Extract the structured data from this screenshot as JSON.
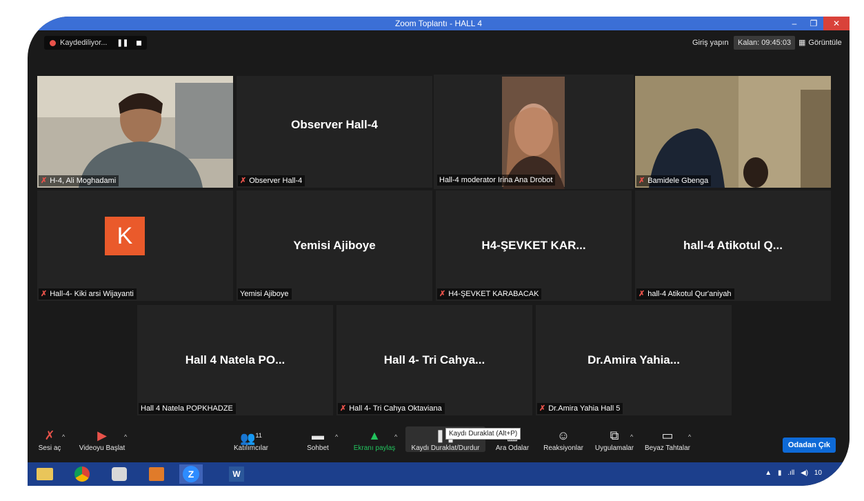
{
  "window": {
    "title": "Zoom Toplantı - HALL 4"
  },
  "recording": {
    "label": "Kaydediliyor...",
    "pause_glyph": "❚❚"
  },
  "topright": {
    "login": "Giriş yapın",
    "remaining": "Kalan: 09:45:03",
    "view": "Görüntüle"
  },
  "tiles": [
    {
      "big": "",
      "name": "H-4, Ali Moghadami",
      "muted": true
    },
    {
      "big": "Observer Hall-4",
      "name": "Observer Hall-4",
      "muted": true
    },
    {
      "big": "",
      "name": "Hall-4 moderator Irina Ana Drobot",
      "muted": false
    },
    {
      "big": "",
      "name": "Bamidele Gbenga",
      "muted": true
    },
    {
      "big": "K",
      "name": "Hall-4- Kiki arsi Wijayanti",
      "muted": true
    },
    {
      "big": "Yemisi Ajiboye",
      "name": "Yemisi Ajiboye",
      "muted": false
    },
    {
      "big": "H4-ŞEVKET  KAR...",
      "name": "H4-ŞEVKET KARABACAK",
      "muted": true
    },
    {
      "big": "hall-4  Atikotul Q...",
      "name": "hall-4 Atikotul Qur'aniyah",
      "muted": true
    },
    {
      "big": "Hall 4 Natela PO...",
      "name": "Hall 4 Natela POPKHADZE",
      "muted": false
    },
    {
      "big": "Hall 4- Tri Cahya...",
      "name": "Hall 4- Tri Cahya Oktaviana",
      "muted": true
    },
    {
      "big": "Dr.Amira  Yahia...",
      "name": "Dr.Amira Yahia Hall 5",
      "muted": true
    }
  ],
  "toolbar": {
    "audio": "Sesi aç",
    "video": "Videoyu Başlat",
    "participants": "Katılımcılar",
    "participants_count": "11",
    "chat": "Sohbet",
    "share": "Ekranı paylaş",
    "record": "Kaydı Duraklat/Durdur",
    "breakout": "Ara Odalar",
    "reactions": "Reaksiyonlar",
    "apps": "Uygulamalar",
    "whiteboard": "Beyaz Tahtalar",
    "leave": "Odadan Çık"
  },
  "tooltip": "Kaydı Duraklat (Alt+P)",
  "colors": {
    "titlebar": "#3b6fd6",
    "share_green": "#22c35d",
    "leave_blue": "#0e6ad7",
    "active_border": "#c9de58",
    "k_avatar": "#ea5a2b"
  },
  "taskbar": {
    "clock": "10"
  }
}
